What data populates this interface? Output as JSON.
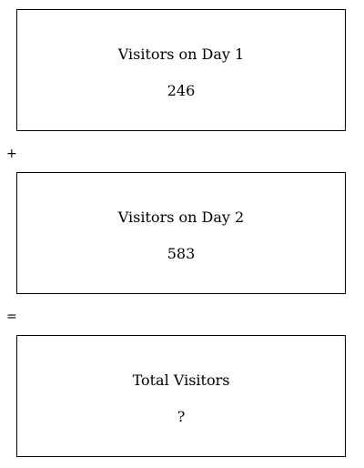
{
  "boxes": {
    "day1": {
      "label": "Visitors on Day 1",
      "value": "246"
    },
    "day2": {
      "label": "Visitors on Day 2",
      "value": "583"
    },
    "total": {
      "label": "Total Visitors",
      "value": "?"
    }
  },
  "operators": {
    "plus": "+",
    "equals": "="
  }
}
